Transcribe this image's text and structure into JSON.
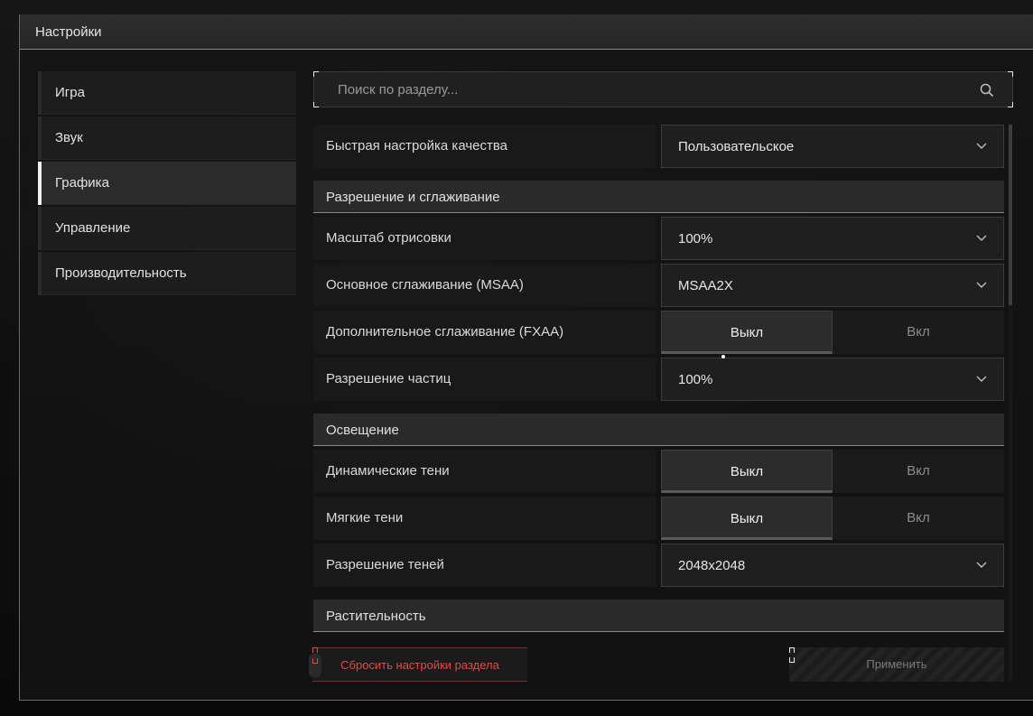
{
  "window": {
    "title": "Настройки"
  },
  "sidebar": {
    "items": [
      {
        "label": "Игра",
        "active": false
      },
      {
        "label": "Звук",
        "active": false
      },
      {
        "label": "Графика",
        "active": true
      },
      {
        "label": "Управление",
        "active": false
      },
      {
        "label": "Производительность",
        "active": false
      }
    ]
  },
  "search": {
    "placeholder": "Поиск по разделу...",
    "value": "",
    "icon": "search-icon"
  },
  "settings": {
    "quality": {
      "label": "Быстрая настройка качества",
      "value": "Пользовательское"
    },
    "section_resolution": "Разрешение и сглаживание",
    "render_scale": {
      "label": "Масштаб отрисовки",
      "value": "100%"
    },
    "msaa": {
      "label": "Основное сглаживание (MSAA)",
      "value": "MSAA2X"
    },
    "fxaa": {
      "label": "Дополнительное сглаживание (FXAA)",
      "off": "Выкл",
      "on": "Вкл",
      "selected": "Выкл"
    },
    "particle_res": {
      "label": "Разрешение частиц",
      "value": "100%"
    },
    "section_lighting": "Освещение",
    "dynamic_shadows": {
      "label": "Динамические тени",
      "off": "Выкл",
      "on": "Вкл",
      "selected": "Выкл"
    },
    "soft_shadows": {
      "label": "Мягкие тени",
      "off": "Выкл",
      "on": "Вкл",
      "selected": "Выкл"
    },
    "shadow_res": {
      "label": "Разрешение теней",
      "value": "2048x2048"
    },
    "section_vegetation": "Растительность"
  },
  "buttons": {
    "reset": "Сбросить настройки раздела",
    "apply": "Применить"
  },
  "colors": {
    "accent_danger": "#e04a4a",
    "active_marker": "#f0f0f0"
  }
}
